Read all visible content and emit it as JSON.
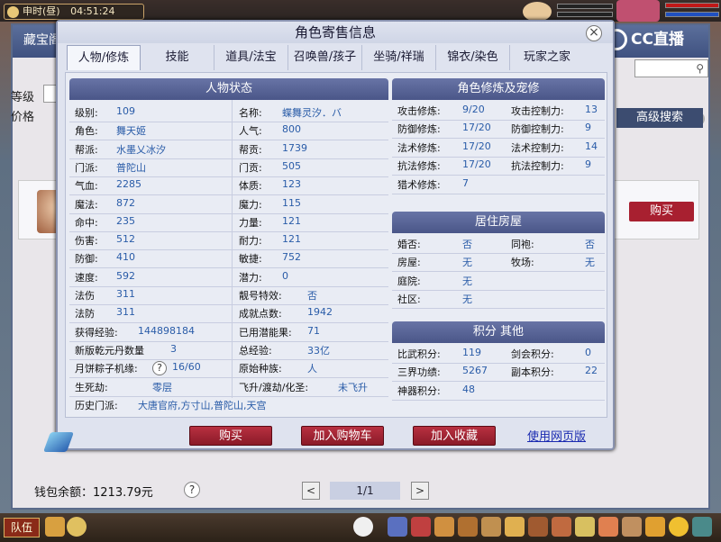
{
  "top": {
    "time_label": "申时(昼)",
    "time": "04:51:24"
  },
  "background_window": {
    "title": "藏宝阁",
    "labels": [
      "等级",
      "价格"
    ],
    "advanced_search": "高级搜索",
    "buy": "购买",
    "wallet": "钱包余额：1213.79元",
    "help": "?",
    "page": "1/1",
    "prev": "<",
    "next": ">"
  },
  "bottom": {
    "team": "队伍"
  },
  "watermark": "CC直播",
  "dialog": {
    "title": "角色寄售信息",
    "close": "×",
    "tabs": [
      "人物/修炼",
      "技能",
      "道具/法宝",
      "召唤兽/孩子",
      "坐骑/祥瑞",
      "锦衣/染色",
      "玩家之家"
    ],
    "status_title": "人物状态",
    "status_left": [
      [
        "级别:",
        "109"
      ],
      [
        "角色:",
        "舞天姬"
      ],
      [
        "帮派:",
        "水墨乂冰汐"
      ],
      [
        "门派:",
        "普陀山"
      ],
      [
        "气血:",
        "2285"
      ],
      [
        "魔法:",
        "872"
      ],
      [
        "命中:",
        "235"
      ],
      [
        "伤害:",
        "512"
      ],
      [
        "防御:",
        "410"
      ],
      [
        "速度:",
        "592"
      ],
      [
        "法伤",
        "311"
      ],
      [
        "法防",
        "311"
      ],
      [
        "获得经验:",
        "144898184"
      ],
      [
        "新版乾元丹数量",
        "3"
      ],
      [
        "月饼粽子机缘:",
        "16/60"
      ],
      [
        "生死劫:",
        "零层"
      ]
    ],
    "status_right": [
      [
        "名称:",
        "蝶舞灵汐．バ"
      ],
      [
        "人气:",
        "800"
      ],
      [
        "帮贡:",
        "1739"
      ],
      [
        "门贡:",
        "505"
      ],
      [
        "体质:",
        "123"
      ],
      [
        "魔力:",
        "115"
      ],
      [
        "力量:",
        "121"
      ],
      [
        "耐力:",
        "121"
      ],
      [
        "敏捷:",
        "752"
      ],
      [
        "潜力:",
        "0"
      ],
      [
        "靓号特效:",
        "否"
      ],
      [
        "成就点数:",
        "1942"
      ],
      [
        "已用潜能果:",
        "71"
      ],
      [
        "总经验:",
        "33亿"
      ],
      [
        "原始种族:",
        "人"
      ],
      [
        "飞升/渡劫/化圣:",
        "未飞升"
      ]
    ],
    "history_label": "历史门派:",
    "history_value": "大唐官府,方寸山,普陀山,天宫",
    "cultivation_title": "角色修炼及宠修",
    "cultivation": [
      [
        "攻击修炼:",
        "9/20",
        "攻击控制力:",
        "13"
      ],
      [
        "防御修炼:",
        "17/20",
        "防御控制力:",
        "9"
      ],
      [
        "法术修炼:",
        "17/20",
        "法术控制力:",
        "14"
      ],
      [
        "抗法修炼:",
        "17/20",
        "抗法控制力:",
        "9"
      ],
      [
        "猎术修炼:",
        "7",
        "",
        ""
      ]
    ],
    "house_title": "居住房屋",
    "house": [
      [
        "婚否:",
        "否",
        "同袍:",
        "否"
      ],
      [
        "房屋:",
        "无",
        "牧场:",
        "无"
      ],
      [
        "庭院:",
        "无",
        "",
        ""
      ],
      [
        "社区:",
        "无",
        "",
        ""
      ]
    ],
    "points_title": "积分 其他",
    "points": [
      [
        "比武积分:",
        "119",
        "剑会积分:",
        "0"
      ],
      [
        "三界功绩:",
        "5267",
        "副本积分:",
        "22"
      ],
      [
        "神器积分:",
        "48",
        "",
        ""
      ]
    ],
    "help": "?",
    "buttons": {
      "buy": "购买",
      "cart": "加入购物车",
      "favorite": "加入收藏",
      "web": "使用网页版"
    }
  }
}
